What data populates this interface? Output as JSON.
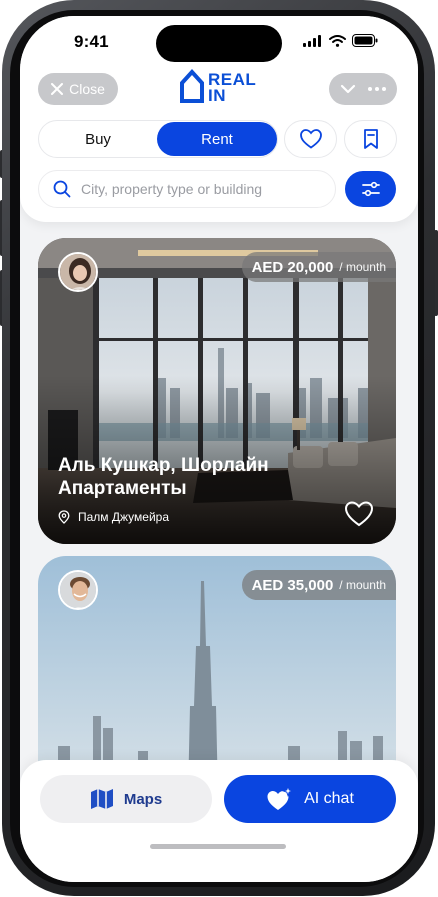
{
  "status_bar": {
    "time": "9:41"
  },
  "header": {
    "close_label": "Close",
    "logo_line1": "REAL",
    "logo_line2": "IN",
    "tabs": [
      {
        "label": "Buy",
        "active": false
      },
      {
        "label": "Rent",
        "active": true
      }
    ],
    "search_placeholder": "City, property type or building"
  },
  "listings": [
    {
      "price": "AED 20,000",
      "period": "/ mounth",
      "title": "Аль Кушкар, Шорлайн Апартаменты",
      "location": "Палм Джумейра"
    },
    {
      "price": "AED 35,000",
      "period": "/ mounth"
    }
  ],
  "bottom_bar": {
    "maps_label": "Maps",
    "ai_chat_label": "AI chat"
  },
  "colors": {
    "accent": "#0a45e0",
    "logo": "#0b4fd6",
    "pill_gray": "#c7c8cb"
  }
}
